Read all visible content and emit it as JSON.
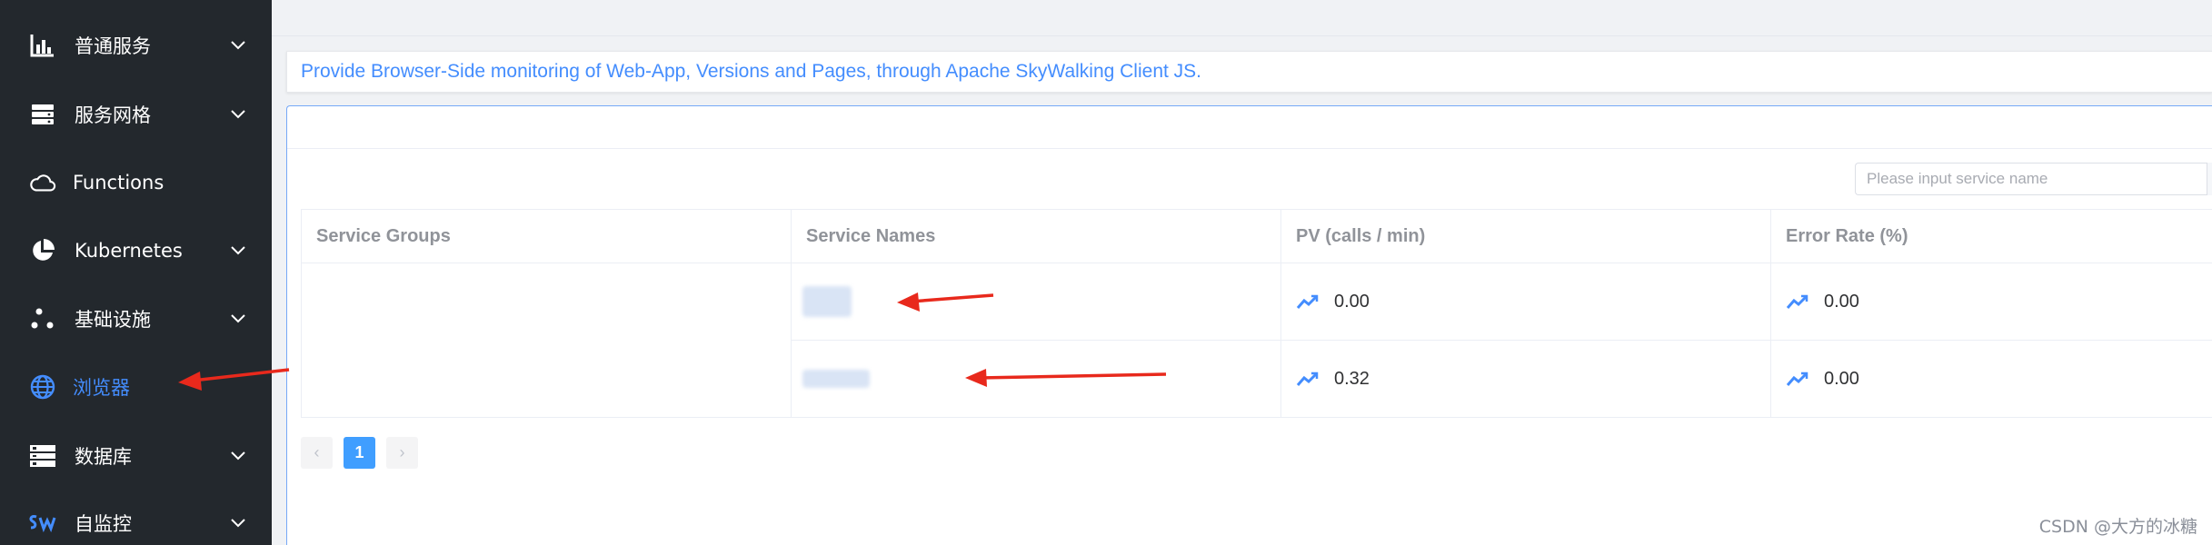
{
  "sidebar": {
    "items": [
      {
        "label": "普通服务",
        "icon": "bar-chart-icon",
        "expandable": true,
        "active": false
      },
      {
        "label": "服务网格",
        "icon": "server-stack-icon",
        "expandable": true,
        "active": false
      },
      {
        "label": "Functions",
        "icon": "cloud-icon",
        "expandable": false,
        "active": false
      },
      {
        "label": "Kubernetes",
        "icon": "pie-chart-icon",
        "expandable": true,
        "active": false
      },
      {
        "label": "基础设施",
        "icon": "nodes-icon",
        "expandable": true,
        "active": false
      },
      {
        "label": "浏览器",
        "icon": "globe-icon",
        "expandable": false,
        "active": true
      },
      {
        "label": "数据库",
        "icon": "database-icon",
        "expandable": true,
        "active": false
      },
      {
        "label": "自监控",
        "icon": "skywalking-logo-icon",
        "expandable": true,
        "active": false
      }
    ]
  },
  "description": "Provide Browser-Side monitoring of Web-App, Versions and Pages, through Apache SkyWalking Client JS.",
  "search": {
    "placeholder": "Please input service name",
    "value": ""
  },
  "table": {
    "columns": [
      "Service Groups",
      "Service Names",
      "PV (calls / min)",
      "Error Rate (%)"
    ],
    "rows": [
      {
        "group": "",
        "name": "",
        "pv": "0.00",
        "error_rate": "0.00"
      },
      {
        "group": "",
        "name": "",
        "pv": "0.32",
        "error_rate": "0.00"
      }
    ]
  },
  "pagination": {
    "current": "1",
    "prev": "‹",
    "next": "›"
  },
  "watermark": "CSDN @大方的冰糖",
  "colors": {
    "sidebar_bg": "#23282d",
    "accent": "#448dfe",
    "annotation_arrow": "#e8291c"
  }
}
